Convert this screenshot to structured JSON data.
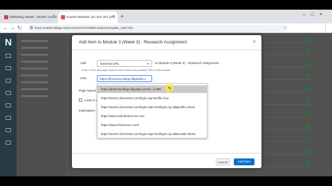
{
  "browser": {
    "tabs": [
      {
        "label": "Marketing Hawaii - DLMS/ Currici"
      },
      {
        "label": "Course Modules: prc-doc-101 [201"
      }
    ],
    "url": "learn.marketcollege.edu/courses/1071999/modules#module_2357791"
  },
  "modal": {
    "title": "Add Item to Module 3 (Week 3) - Research Assignment",
    "add_label": "Add",
    "type_value": "External URL",
    "to_text": "to Module 3 (Week 3) - Research Assignment",
    "hint": "Enter a URL and page name to add a link to any website URL to this module.",
    "url_label": "URL:",
    "url_value": "https://phoenixcollege.libguides.c",
    "page_name_label": "Page Name:",
    "load_label": "Load in a new tab",
    "indentation_label": "Indentation:",
    "cancel_label": "Cancel",
    "add_item_label": "Add Item"
  },
  "suggestions": [
    "https://phoenixcollege.libguides.com/c.../LIBR",
    "https://search.ebscohost.com/login.asp?profile=hcp",
    "https://search.ebscohost.com/login.aspx?authtype=ip,uid&profile=ehost",
    "https://www.oxfordreference.com",
    "https://www.infoscience.com/",
    "https://search.ebscohost.com/login.aspx?authtype=ip,uid&custid=s8263"
  ],
  "colors": {
    "primary_button": "#0770cf",
    "check_green": "#2e6e3e"
  }
}
